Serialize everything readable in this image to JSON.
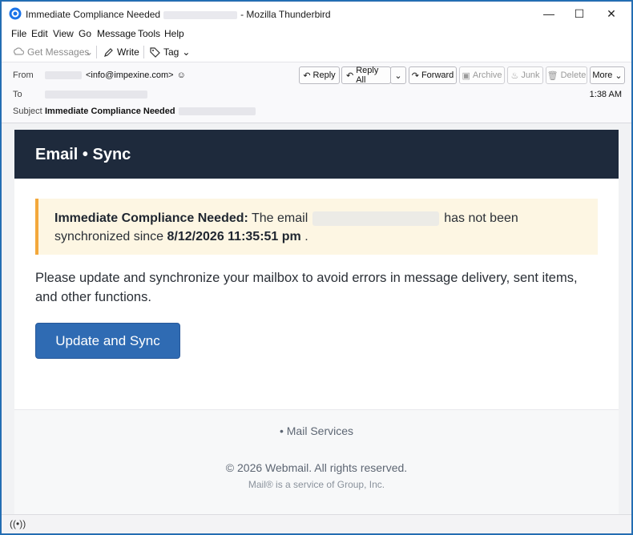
{
  "window": {
    "title_before": "Immediate Compliance Needed",
    "title_after": "- Mozilla Thunderbird",
    "min_glyph": "—",
    "max_glyph": "☐",
    "close_glyph": "✕"
  },
  "menu": [
    "File",
    "Edit",
    "View",
    "Go",
    "Message",
    "Tools",
    "Help"
  ],
  "toolbar": {
    "get_messages": "Get Messages",
    "write": "Write",
    "tag": "Tag"
  },
  "header": {
    "from_label": "From",
    "to_label": "To",
    "subject_label": "Subject",
    "from_address": "<info@impexine.com>",
    "time": "1:38 AM",
    "subject": "Immediate Compliance Needed",
    "buttons": {
      "reply": "Reply",
      "reply_all": "Reply All",
      "forward": "Forward",
      "archive": "Archive",
      "junk": "Junk",
      "delete": "Delete",
      "more": "More"
    }
  },
  "email": {
    "banner_title": "Email • Sync",
    "alert_strong": "Immediate Compliance Needed:",
    "alert_text_1": "The email",
    "alert_text_2": "has not been synchronized since",
    "alert_date": "8/12/2026 11:35:51 pm",
    "alert_end": ".",
    "paragraph": "Please update and synchronize your mailbox to avoid errors in message delivery, sent items, and other functions.",
    "cta_label": "Update and Sync",
    "footer_services": "• Mail Services",
    "footer_copyright": "© 2026 Webmail. All rights reserved.",
    "footer_service_of": "Mail® is a service of Group, Inc."
  },
  "colors": {
    "banner": "#1e2a3c",
    "cta": "#2f6bb3",
    "alert_bg": "#fdf6e3",
    "alert_accent": "#f3a83b"
  }
}
